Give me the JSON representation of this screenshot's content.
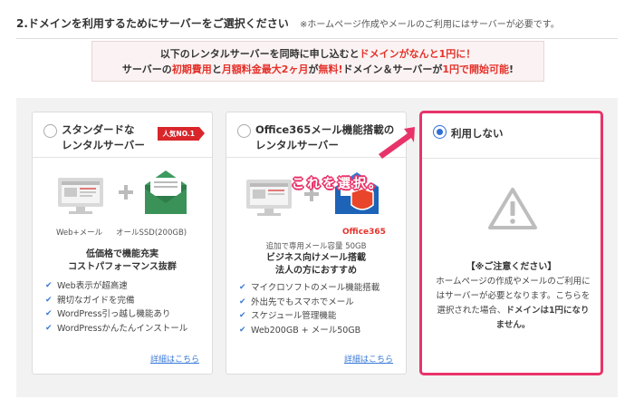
{
  "header": {
    "title": "2.ドメインを利用するためにサーバーをご選択ください",
    "note": "※ホームページ作成やメールのご利用にはサーバーが必要です。"
  },
  "promo": {
    "line1_a": "以下のレンタルサーバーを同時に申し込むと",
    "line1_b": "ドメインがなんと1円に！",
    "line2_a": "サーバーの",
    "line2_b": "初期費用",
    "line2_c": "と",
    "line2_d": "月額料金最大2ヶ月",
    "line2_e": "が",
    "line2_f": "無料!",
    "line2_g": "ドメイン＆サーバーが",
    "line2_h": "1円で開始可能",
    "line2_i": "!"
  },
  "cards": [
    {
      "title_line1": "スタンダードな",
      "title_line2": "レンタルサーバー",
      "badge": "人気NO.1",
      "cap_left": "Web+メール",
      "cap_right": "オールSSD(200GB)",
      "feature_line1": "低価格で機能充実",
      "feature_line2": "コストパフォーマンス抜群",
      "features": [
        "Web表示が超高速",
        "親切なガイドを完備",
        "WordPress引っ越し機能あり",
        "WordPressかんたんインストール"
      ],
      "link": "詳細はこちら",
      "selected": false
    },
    {
      "title_line1": "Office365メール機能搭載の",
      "title_line2": "レンタルサーバー",
      "office_label": "Office365",
      "cap_small": "追加で専用メール容量 50GB",
      "feature_line1": "ビジネス向けメール搭載",
      "feature_line2": "法人の方におすすめ",
      "features": [
        "マイクロソフトのメール機能搭載",
        "外出先でもスマホでメール",
        "スケジュール管理機能",
        "Web200GB + メール50GB"
      ],
      "link": "詳細はこちら",
      "selected": false
    },
    {
      "title": "利用しない",
      "caution_title": "【※ご注意ください】",
      "caution_1": "ホームページの作成やメールのご利用にはサーバーが必要となります。",
      "caution_2": "こちらを選択された場合、",
      "caution_3": "ドメインは1円になりません。",
      "selected": true
    }
  ],
  "callout": "これを選択。",
  "colors": {
    "accent_red": "#e4322b",
    "highlight_pink": "#e8336a",
    "radio_blue": "#2f6fd6",
    "link_blue": "#3a79d8"
  }
}
